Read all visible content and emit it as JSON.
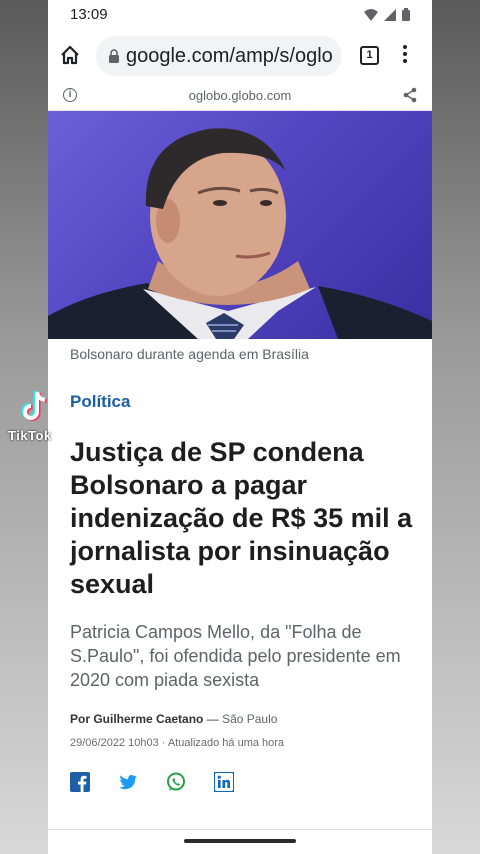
{
  "status_bar": {
    "time": "13:09"
  },
  "browser": {
    "url": "google.com/amp/s/oglo",
    "tab_count": "1"
  },
  "amp_header": {
    "domain": "oglobo.globo.com"
  },
  "article": {
    "photo_caption": "Bolsonaro durante agenda em Brasília",
    "category": "Política",
    "headline": "Justiça de SP condena Bolsonaro a pagar indenização de R$ 35 mil a jornalista por insinuação sexual",
    "subtitle": "Patricia Campos Mello, da \"Folha de S.Paulo\", foi ofendida pelo presidente em 2020 com piada sexista",
    "author": "Por Guilherme Caetano",
    "city": "São Paulo",
    "date": "29/06/2022 10h03 · Atualizado há uma hora"
  },
  "share_icons": [
    "facebook-icon",
    "twitter-icon",
    "whatsapp-icon",
    "linkedin-icon"
  ],
  "overlay": {
    "brand": "TikTok"
  },
  "colors": {
    "category": "#1a5ea8",
    "facebook": "#1f5fa8",
    "twitter": "#1d9bf0",
    "whatsapp": "#25a244",
    "linkedin": "#0a66c2"
  }
}
